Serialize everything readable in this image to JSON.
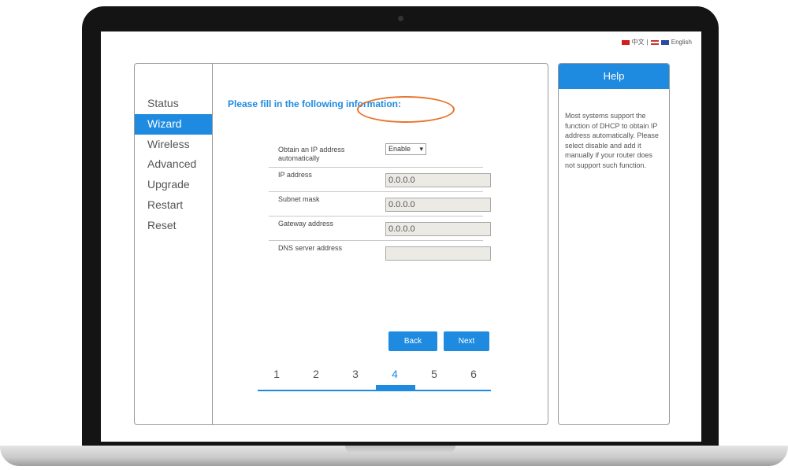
{
  "language": {
    "chinese": "中文",
    "english": "English"
  },
  "nav": {
    "items": [
      {
        "label": "Status"
      },
      {
        "label": "Wizard"
      },
      {
        "label": "Wireless"
      },
      {
        "label": "Advanced"
      },
      {
        "label": "Upgrade"
      },
      {
        "label": "Restart"
      },
      {
        "label": "Reset"
      }
    ],
    "active": "Wizard"
  },
  "main": {
    "heading": "Please fill in the following information:",
    "form": {
      "obtain_ip_label": "Obtain an IP address automatically",
      "obtain_ip_value": "Enable",
      "ip_label": "IP address",
      "ip_value": "0.0.0.0",
      "subnet_label": "Subnet mask",
      "subnet_value": "0.0.0.0",
      "gateway_label": "Gateway address",
      "gateway_value": "0.0.0.0",
      "dns_label": "DNS server address",
      "dns_value": ""
    },
    "buttons": {
      "back": "Back",
      "next": "Next"
    },
    "steps": [
      "1",
      "2",
      "3",
      "4",
      "5",
      "6"
    ],
    "current_step": "4"
  },
  "help": {
    "title": "Help",
    "text": "Most systems support the function of DHCP to obtain IP address automatically. Please select disable and add it manually if your router does not support such function."
  },
  "colors": {
    "accent": "#1e8be0",
    "highlight_circle": "#e8742b"
  }
}
